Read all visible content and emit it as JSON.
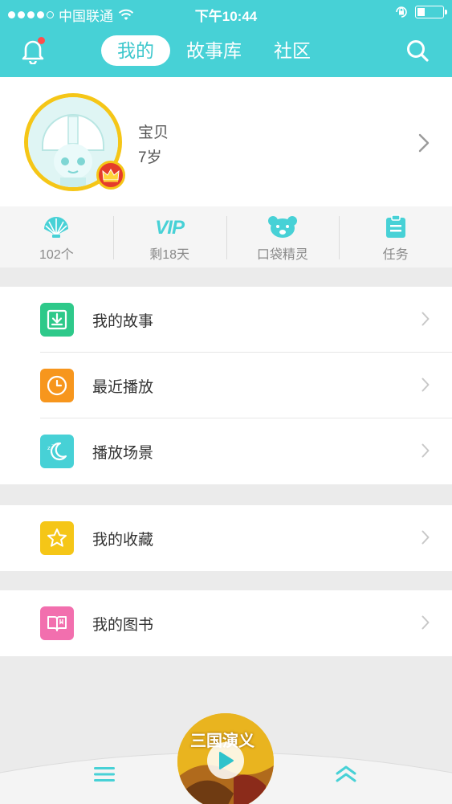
{
  "status_bar": {
    "carrier": "中国联通",
    "time": "下午10:44"
  },
  "header": {
    "tabs": [
      {
        "label": "我的",
        "active": true
      },
      {
        "label": "故事库",
        "active": false
      },
      {
        "label": "社区",
        "active": false
      }
    ],
    "bell_has_badge": true
  },
  "profile": {
    "name": "宝贝",
    "age": "7岁"
  },
  "stats": [
    {
      "icon": "shell-icon",
      "label": "102个"
    },
    {
      "icon_text": "VIP",
      "label": "剩18天"
    },
    {
      "icon": "bear-icon",
      "label": "口袋精灵"
    },
    {
      "icon": "clipboard-icon",
      "label": "任务"
    }
  ],
  "menu_groups": [
    [
      {
        "icon": "download-icon",
        "color": "#2ec98a",
        "label": "我的故事"
      },
      {
        "icon": "clock-icon",
        "color": "#f7961d",
        "label": "最近播放"
      },
      {
        "icon": "moon-icon",
        "color": "#47d1d6",
        "label": "播放场景"
      }
    ],
    [
      {
        "icon": "star-icon",
        "color": "#f5c617",
        "label": "我的收藏"
      }
    ],
    [
      {
        "icon": "book-icon",
        "color": "#f26fae",
        "label": "我的图书"
      }
    ]
  ],
  "player": {
    "cover_title": "三国演义"
  },
  "colors": {
    "accent": "#47d1d6",
    "background": "#ebebeb"
  }
}
